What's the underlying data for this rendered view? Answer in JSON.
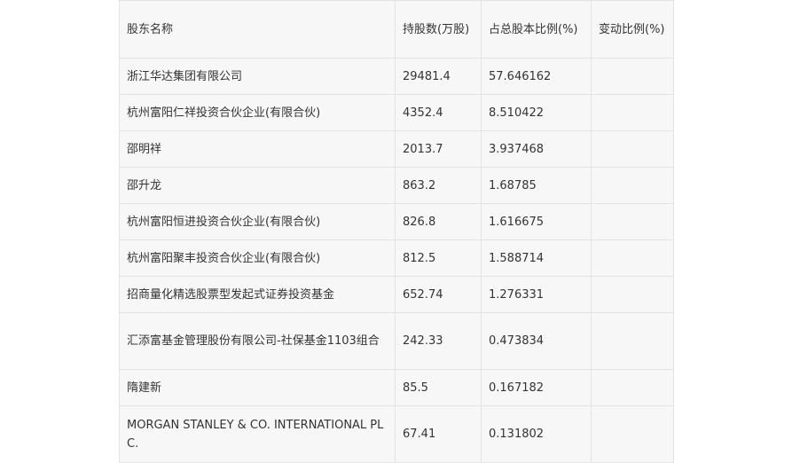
{
  "table": {
    "headers": [
      "股东名称",
      "持股数(万股)",
      "占总股本比例(%)",
      "变动比例(%)"
    ],
    "rows": [
      {
        "name": "浙江华达集团有限公司",
        "shares": "29481.4",
        "ratio": "57.646162",
        "change": ""
      },
      {
        "name": "杭州富阳仁祥投资合伙企业(有限合伙)",
        "shares": "4352.4",
        "ratio": "8.510422",
        "change": ""
      },
      {
        "name": "邵明祥",
        "shares": "2013.7",
        "ratio": "3.937468",
        "change": ""
      },
      {
        "name": "邵升龙",
        "shares": "863.2",
        "ratio": "1.68785",
        "change": ""
      },
      {
        "name": "杭州富阳恒进投资合伙企业(有限合伙)",
        "shares": "826.8",
        "ratio": "1.616675",
        "change": ""
      },
      {
        "name": "杭州富阳聚丰投资合伙企业(有限合伙)",
        "shares": "812.5",
        "ratio": "1.588714",
        "change": ""
      },
      {
        "name": "招商量化精选股票型发起式证券投资基金",
        "shares": "652.74",
        "ratio": "1.276331",
        "change": ""
      },
      {
        "name": "汇添富基金管理股份有限公司-社保基金1103组合",
        "shares": "242.33",
        "ratio": "0.473834",
        "change": ""
      },
      {
        "name": "隋建新",
        "shares": "85.5",
        "ratio": "0.167182",
        "change": ""
      },
      {
        "name": "MORGAN STANLEY & CO. INTERNATIONAL PLC.",
        "shares": "67.41",
        "ratio": "0.131802",
        "change": ""
      }
    ]
  }
}
